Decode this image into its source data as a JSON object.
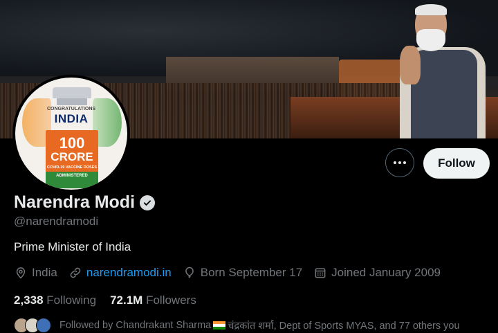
{
  "profile": {
    "name": "Narendra Modi",
    "handle": "@narendramodi",
    "bio": "Prime Minister of India",
    "location": "India",
    "website": "narendramodi.in",
    "birthday": "Born September 17",
    "joined": "Joined January 2009"
  },
  "avatar": {
    "line_small": "CONGRATULATIONS",
    "line_country": "INDIA",
    "line_number": "100",
    "line_unit": "CRORE",
    "line_doses": "COVID-19 VACCINE DOSES",
    "line_admin": "ADMINISTERED"
  },
  "actions": {
    "follow_label": "Follow"
  },
  "stats": {
    "following_count": "2,338",
    "following_label": "Following",
    "followers_count": "72.1M",
    "followers_label": "Followers"
  },
  "followed_by": {
    "prefix": "Followed by Chandrakant Sharma",
    "suffix": "चंद्रकांत शर्मा, Dept of Sports MYAS, and 77 others you"
  },
  "colors": {
    "background": "#000000",
    "link": "#1d9bf0",
    "secondary_text": "#71767b",
    "follow_button_bg": "#eff3f4"
  }
}
